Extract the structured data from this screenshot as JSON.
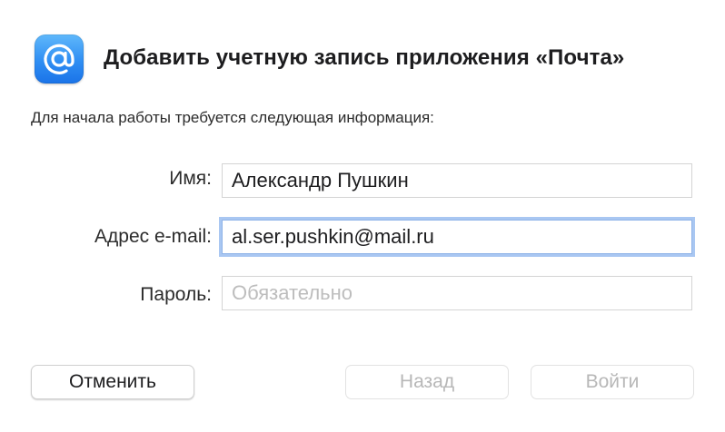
{
  "dialog": {
    "title": "Добавить учетную запись приложения «Почта»",
    "subtitle": "Для начала работы требуется следующая информация:",
    "icon": "mail-at-icon"
  },
  "form": {
    "name": {
      "label": "Имя:",
      "value": "Александр Пушкин",
      "placeholder": ""
    },
    "email": {
      "label": "Адрес e-mail:",
      "value": "al.ser.pushkin@mail.ru",
      "placeholder": ""
    },
    "password": {
      "label": "Пароль:",
      "value": "",
      "placeholder": "Обязательно"
    }
  },
  "buttons": {
    "cancel": "Отменить",
    "back": "Назад",
    "signin": "Войти"
  },
  "colors": {
    "icon_blue": "#2f8ef3",
    "focus_ring": "#a9c7f2",
    "disabled_text": "#b7b7b7"
  }
}
